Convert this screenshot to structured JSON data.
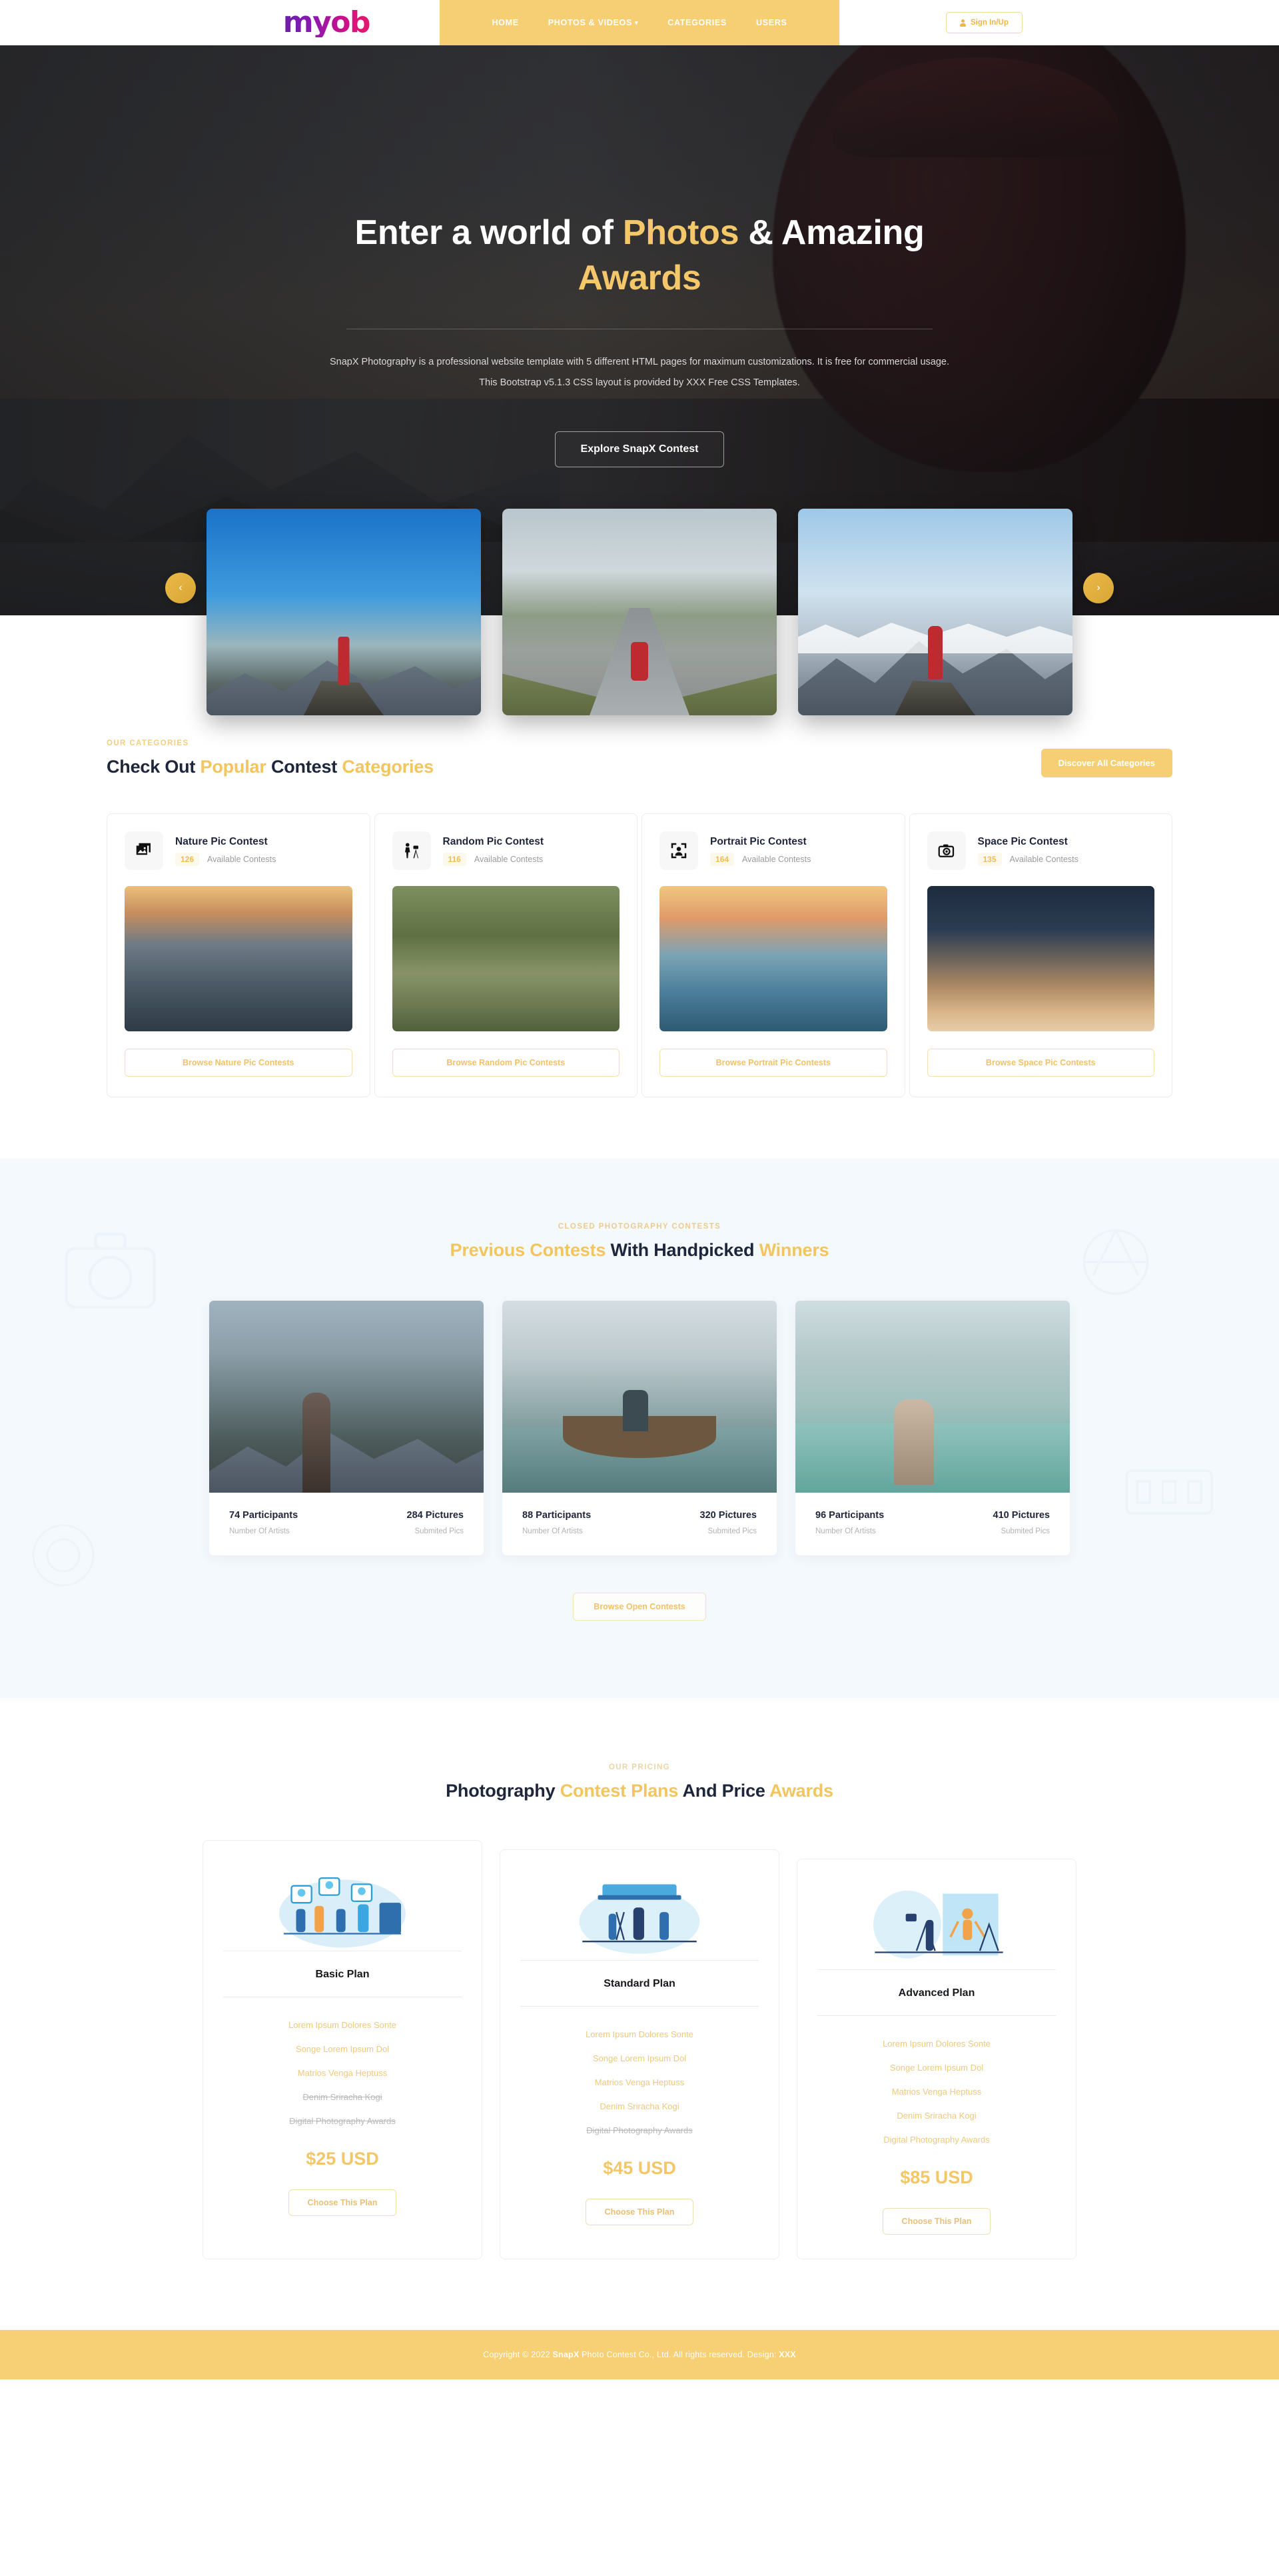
{
  "header": {
    "logo_text": "myob",
    "nav": [
      {
        "label": "HOME",
        "has_caret": false
      },
      {
        "label": "PHOTOS & VIDEOS",
        "has_caret": true
      },
      {
        "label": "CATEGORIES",
        "has_caret": false
      },
      {
        "label": "USERS",
        "has_caret": false
      }
    ],
    "signin_label": "Sign In/Up"
  },
  "hero": {
    "title_part1": "Enter a world of ",
    "title_highlight1": "Photos",
    "title_part2": " & Amazing ",
    "title_highlight2": "Awards",
    "subtitle": "SnapX Photography is a professional website template with 5 different HTML pages for maximum customizations. It is free for commercial usage. This Bootstrap v5.1.3 CSS layout is provided by XXX Free CSS Templates.",
    "cta_label": "Explore SnapX Contest",
    "prev_arrow": "‹",
    "next_arrow": "›"
  },
  "categories": {
    "eyebrow": "OUR CATEGORIES",
    "title_part1": "Check Out ",
    "title_hl1": "Popular",
    "title_part2": " Contest ",
    "title_hl2": "Categories",
    "discover_label": "Discover All Categories",
    "items": [
      {
        "name": "Nature Pic Contest",
        "count": "126",
        "sub": "Available Contests",
        "button": "Browse Nature Pic Contests",
        "icon": "photos-stack-icon"
      },
      {
        "name": "Random Pic Contest",
        "count": "116",
        "sub": "Available Contests",
        "button": "Browse Random Pic Contests",
        "icon": "photographer-tripod-icon"
      },
      {
        "name": "Portrait Pic Contest",
        "count": "164",
        "sub": "Available Contests",
        "button": "Browse Portrait Pic Contests",
        "icon": "portrait-frame-icon"
      },
      {
        "name": "Space Pic Contest",
        "count": "135",
        "sub": "Available Contests",
        "button": "Browse Space Pic Contests",
        "icon": "camera-icon"
      }
    ]
  },
  "previous": {
    "eyebrow": "CLOSED PHOTOGRAPHY CONTESTS",
    "title_hl1": "Previous Contests",
    "title_part2": " With Handpicked ",
    "title_hl2": "Winners",
    "browse_label": "Browse Open Contests",
    "cards": [
      {
        "participants": "74 Participants",
        "participants_label": "Number Of Artists",
        "pictures": "284 Pictures",
        "pictures_label": "Submited Pics"
      },
      {
        "participants": "88 Participants",
        "participants_label": "Number Of Artists",
        "pictures": "320 Pictures",
        "pictures_label": "Submited Pics"
      },
      {
        "participants": "96 Participants",
        "participants_label": "Number Of Artists",
        "pictures": "410 Pictures",
        "pictures_label": "Submited Pics"
      }
    ]
  },
  "pricing": {
    "eyebrow": "OUR PRICING",
    "title_part1": "Photography ",
    "title_hl1": "Contest Plans",
    "title_part2": " And Price ",
    "title_hl2": "Awards",
    "plans": [
      {
        "name": "Basic Plan",
        "price": "$25 USD",
        "button": "Choose This Plan",
        "features": [
          {
            "text": "Lorem Ipsum Dolores Sonte",
            "enabled": true
          },
          {
            "text": "Songe Lorem Ipsum Dol",
            "enabled": true
          },
          {
            "text": "Matrios Venga Heptuss",
            "enabled": true
          },
          {
            "text": "Denim Sriracha Kogi",
            "enabled": false
          },
          {
            "text": "Digital Photography Awards",
            "enabled": false
          }
        ]
      },
      {
        "name": "Standard Plan",
        "price": "$45 USD",
        "button": "Choose This Plan",
        "features": [
          {
            "text": "Lorem Ipsum Dolores Sonte",
            "enabled": true
          },
          {
            "text": "Songe Lorem Ipsum Dol",
            "enabled": true
          },
          {
            "text": "Matrios Venga Heptuss",
            "enabled": true
          },
          {
            "text": "Denim Sriracha Kogi",
            "enabled": true
          },
          {
            "text": "Digital Photography Awards",
            "enabled": false
          }
        ]
      },
      {
        "name": "Advanced Plan",
        "price": "$85 USD",
        "button": "Choose This Plan",
        "features": [
          {
            "text": "Lorem Ipsum Dolores Sonte",
            "enabled": true
          },
          {
            "text": "Songe Lorem Ipsum Dol",
            "enabled": true
          },
          {
            "text": "Matrios Venga Heptuss",
            "enabled": true
          },
          {
            "text": "Denim Sriracha Kogi",
            "enabled": true
          },
          {
            "text": "Digital Photography Awards",
            "enabled": true
          }
        ]
      }
    ]
  },
  "footer": {
    "prefix": "Copyright © 2022 ",
    "brand": "SnapX",
    "middle": " Photo Contest Co., Ltd. All rights reserved. Design: ",
    "designer": "XXX"
  },
  "colors": {
    "accent": "#f6cf74",
    "accent_text": "#f2c55f",
    "dark": "#1d263b",
    "muted": "#9a9a9a",
    "prev_bg": "#f4f9fd"
  }
}
